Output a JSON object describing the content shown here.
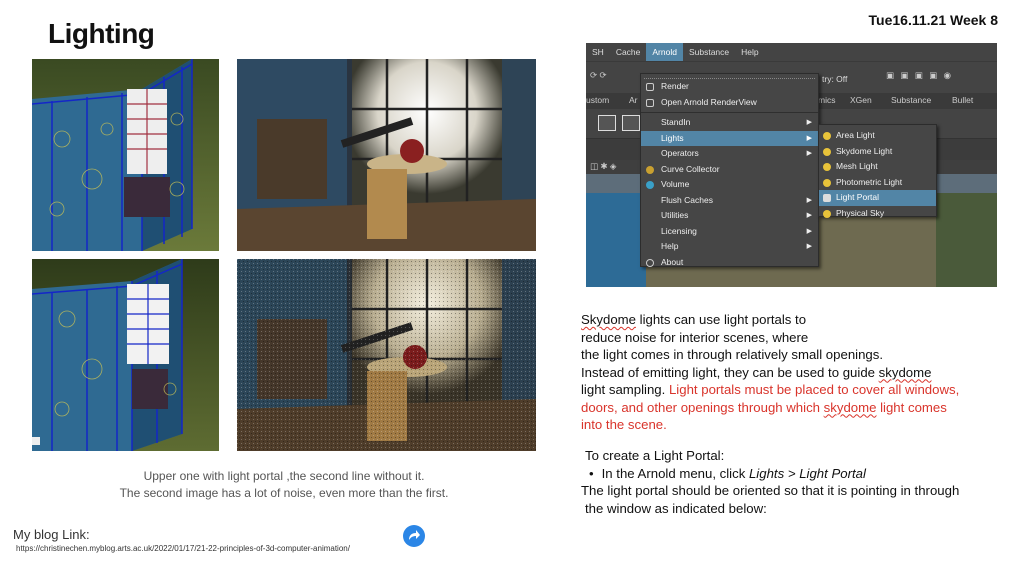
{
  "slide": {
    "title": "Lighting",
    "date": "Tue16.11.21 Week 8"
  },
  "renders": [
    {
      "name": "house-with-portal"
    },
    {
      "name": "room-with-portal"
    },
    {
      "name": "house-without-portal"
    },
    {
      "name": "room-without-portal"
    }
  ],
  "caption": {
    "line1": "Upper one with light portal ,the second line without it.",
    "line2": "The second image has a lot of noise, even more than the first."
  },
  "blog": {
    "label": "My blog Link:",
    "url": "https://christinechen.myblog.arts.ac.uk/2022/01/17/21-22-principles-of-3d-computer-animation/"
  },
  "maya": {
    "menubar": [
      "SH",
      "Cache",
      "Arnold",
      "Substance",
      "Help"
    ],
    "active_menu": "Arnold",
    "toolbar_text": "try: Off",
    "tabs": [
      "ustom",
      "Ar",
      "mics",
      "XGen",
      "Substance",
      "Bullet"
    ],
    "arnold_menu": {
      "group1": [
        "Render",
        "Open Arnold RenderView"
      ],
      "group2": [
        "StandIn",
        "Lights",
        "Operators",
        "Curve Collector",
        "Volume",
        "Flush Caches",
        "Utilities",
        "Licensing",
        "Help",
        "About"
      ]
    },
    "lights_submenu": [
      "Area Light",
      "Skydome Light",
      "Mesh Light",
      "Photometric Light",
      "Light Portal",
      "Physical Sky"
    ],
    "highlighted_menu": "Lights",
    "highlighted_submenu": "Light Portal",
    "accent": "#5285a6"
  },
  "text": {
    "p1_a": "Skydome",
    "p1_b": " lights can use light portals to",
    "p2": "reduce noise for interior scenes, where",
    "p3": "the light comes in through relatively small openings.",
    "p4_a": "Instead of emitting light, they can be used to guide ",
    "p4_b": "skydome",
    "p5_a": "light sampling. ",
    "p5_red": "Light portals must be placed to cover all windows,",
    "p6_red_a": "doors, and other openings through which ",
    "p6_red_b": "skydome",
    "p6_red_c": " light comes",
    "p7_red": "into the scene.",
    "howto_title": "To create a Light Portal:",
    "howto_bullet_a": "In the Arnold menu, click ",
    "howto_bullet_b": "Lights > Light Portal",
    "howto_l3": "The light portal should be oriented so that it is pointing in through",
    "howto_l4": "the window as indicated below:",
    "red_color": "#d9342b"
  }
}
